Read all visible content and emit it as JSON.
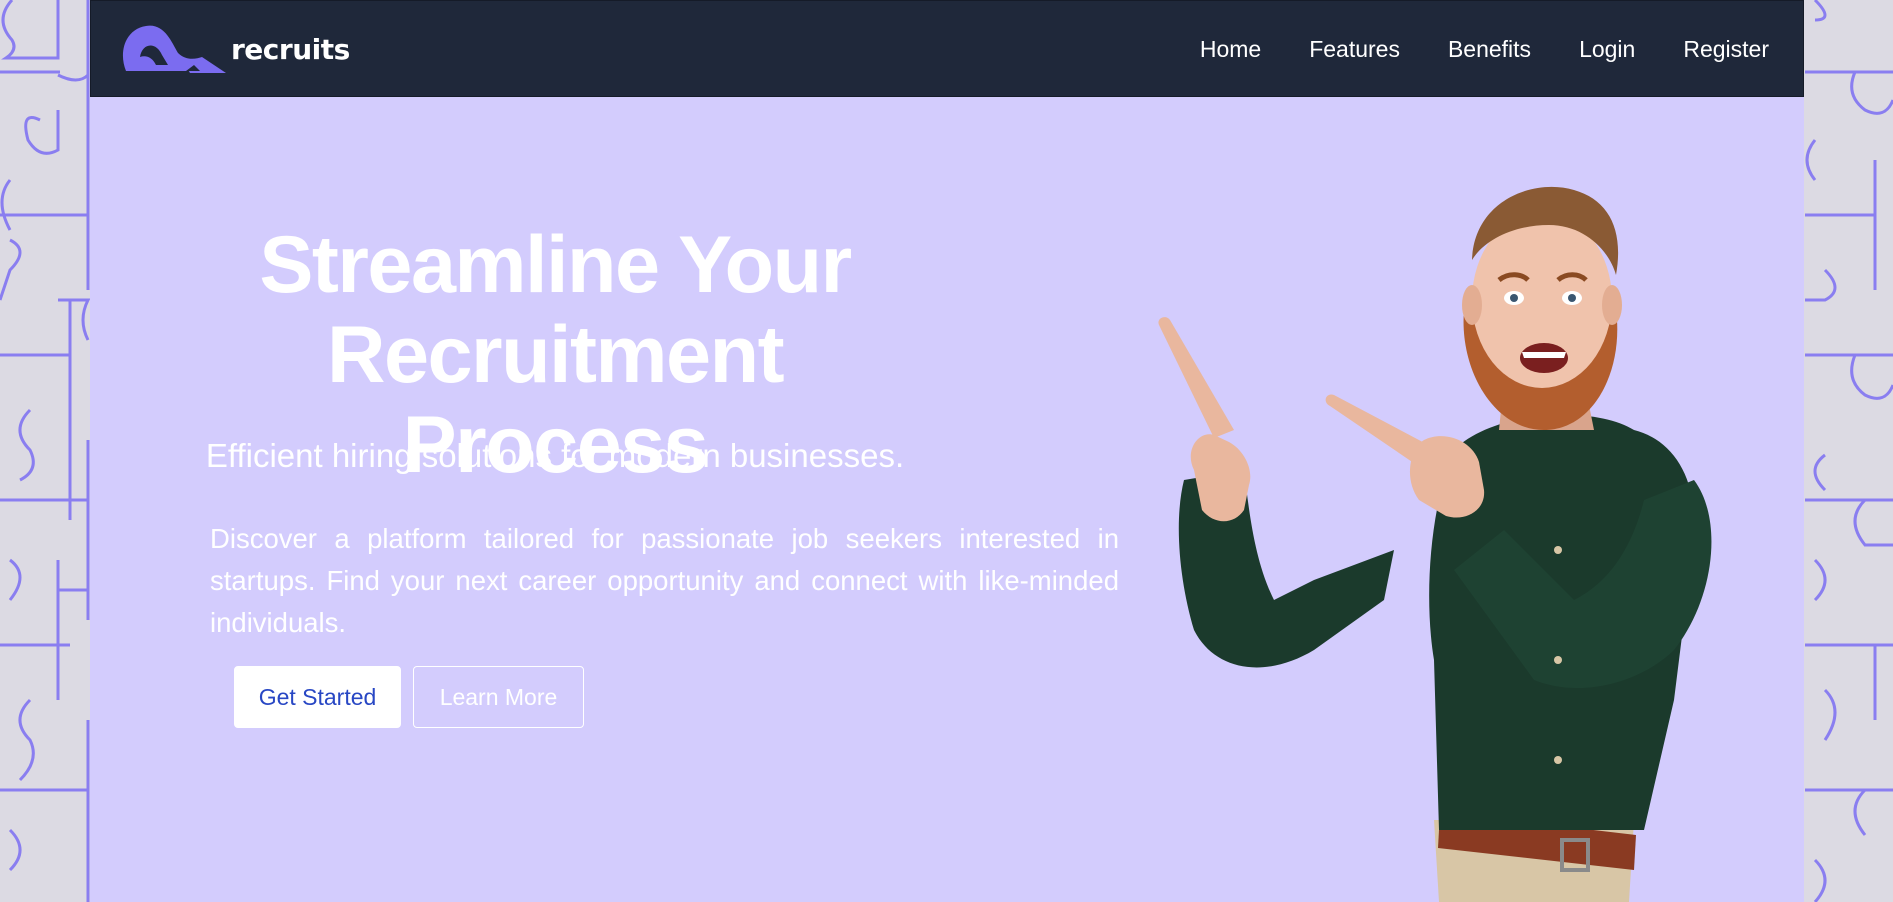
{
  "brand": {
    "name": "recruits",
    "logo_icon": "recruits-logo",
    "logo_color": "#7b6cf0"
  },
  "nav": {
    "links": [
      "Home",
      "Features",
      "Benefits",
      "Login",
      "Register"
    ]
  },
  "hero": {
    "title_line1": "Streamline Your",
    "title_line2": "Recruitment Process",
    "subtitle": "Efficient hiring solutions for modern businesses.",
    "description": "Discover a platform tailored for passionate job seekers interested in startups. Find your next career opportunity and connect with like-minded individuals.",
    "primary_button": "Get Started",
    "secondary_button": "Learn More",
    "image": "pointing-man-photo"
  },
  "colors": {
    "navbar": "#1f283a",
    "hero_background": "#d3ccfd",
    "page_background": "#dcdae3",
    "puzzle_stroke": "#8a7ef0",
    "primary_button_text": "#2847c4"
  }
}
